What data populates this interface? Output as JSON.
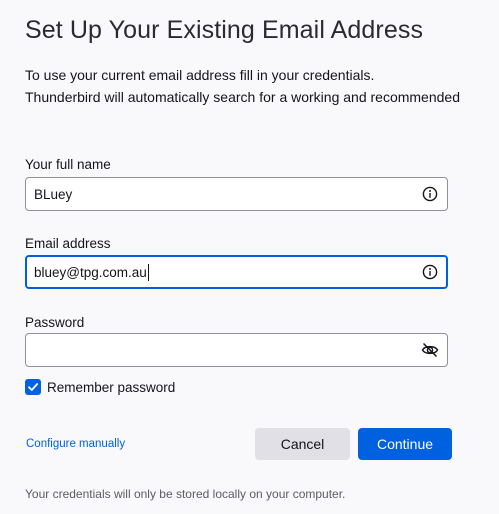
{
  "page": {
    "title": "Set Up Your Existing Email Address",
    "intro_line1": "To use your current email address fill in your credentials.",
    "intro_line2": "Thunderbird will automatically search for a working and recommended"
  },
  "form": {
    "fullname_label": "Your full name",
    "fullname_value": "BLuey",
    "email_label": "Email address",
    "email_value": "bluey@tpg.com.au",
    "password_label": "Password",
    "password_value": "",
    "remember_label": "Remember password",
    "remember_checked": true
  },
  "actions": {
    "configure_manually": "Configure manually",
    "cancel": "Cancel",
    "continue": "Continue"
  },
  "footer": {
    "note": "Your credentials will only be stored locally on your computer."
  },
  "colors": {
    "accent": "#0061e0",
    "background": "#f9f9fb",
    "cancel_bg": "#e0e0e6"
  },
  "icons": {
    "fullname_info": "info-icon",
    "email_info": "info-icon",
    "password_toggle": "eye-slash-icon",
    "checkbox": "checkmark-icon"
  }
}
